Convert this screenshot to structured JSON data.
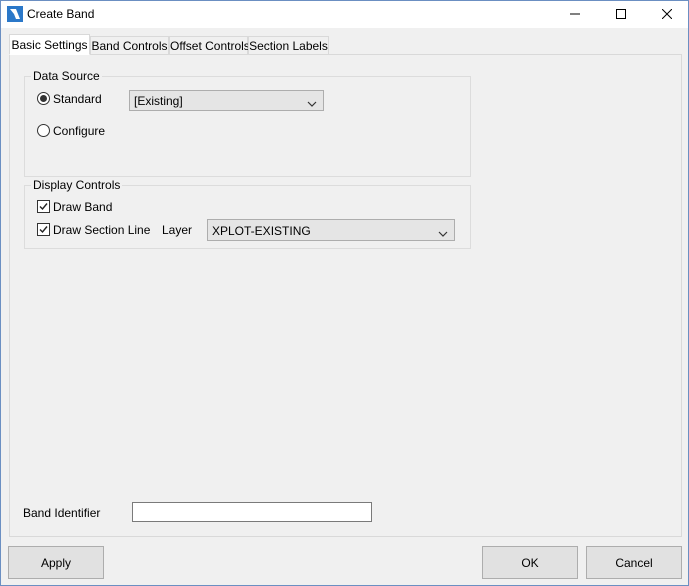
{
  "window": {
    "title": "Create Band",
    "icon": "app-logo-icon",
    "controls": [
      "minimize-icon",
      "maximize-icon",
      "close-icon"
    ]
  },
  "tabs": [
    {
      "label": "Basic Settings",
      "active": true
    },
    {
      "label": "Band Controls",
      "active": false
    },
    {
      "label": "Offset Controls",
      "active": false
    },
    {
      "label": "Section Labels",
      "active": false
    }
  ],
  "data_source": {
    "title": "Data Source",
    "standard_label": "Standard",
    "standard_selected": true,
    "standard_value": "[Existing]",
    "configure_label": "Configure",
    "configure_selected": false
  },
  "display_controls": {
    "title": "Display Controls",
    "draw_band_label": "Draw Band",
    "draw_band_checked": true,
    "draw_section_line_label": "Draw Section Line",
    "draw_section_line_checked": true,
    "layer_label": "Layer",
    "layer_value": "XPLOT-EXISTING"
  },
  "band_identifier": {
    "label": "Band Identifier",
    "value": ""
  },
  "buttons": {
    "apply": "Apply",
    "ok": "OK",
    "cancel": "Cancel"
  }
}
